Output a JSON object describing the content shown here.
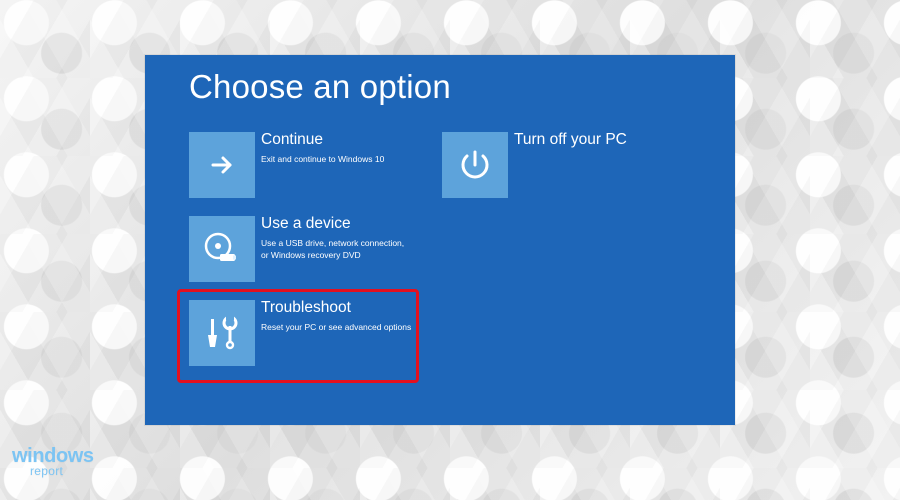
{
  "screen": {
    "title": "Choose an option",
    "options": [
      {
        "label": "Continue",
        "description": "Exit and continue to Windows 10",
        "icon": "arrow-right-icon"
      },
      {
        "label": "Use a device",
        "description": "Use a USB drive, network connection,\nor Windows recovery DVD",
        "icon": "disc-usb-icon"
      },
      {
        "label": "Troubleshoot",
        "description": "Reset your PC or see advanced options",
        "icon": "tools-icon",
        "highlighted": true
      },
      {
        "label": "Turn off your PC",
        "description": "",
        "icon": "power-icon"
      }
    ]
  },
  "watermark": {
    "top": "windows",
    "bottom": "report"
  },
  "colors": {
    "screen_background": "#1e66b8",
    "tile_background": "#5da3db",
    "highlight": "#e3101f",
    "watermark": "#7cc4f3"
  }
}
